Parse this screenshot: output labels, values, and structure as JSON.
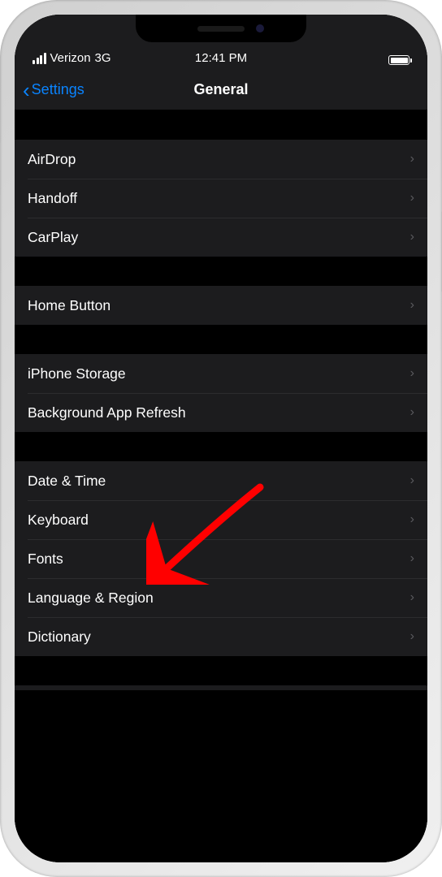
{
  "status_bar": {
    "carrier": "Verizon",
    "network": "3G",
    "time": "12:41 PM"
  },
  "nav": {
    "back_label": "Settings",
    "title": "General"
  },
  "sections": [
    {
      "items": [
        "AirDrop",
        "Handoff",
        "CarPlay"
      ]
    },
    {
      "items": [
        "Home Button"
      ]
    },
    {
      "items": [
        "iPhone Storage",
        "Background App Refresh"
      ]
    },
    {
      "items": [
        "Date & Time",
        "Keyboard",
        "Fonts",
        "Language & Region",
        "Dictionary"
      ]
    }
  ],
  "annotation": {
    "target": "Keyboard",
    "color": "#ff0000"
  }
}
